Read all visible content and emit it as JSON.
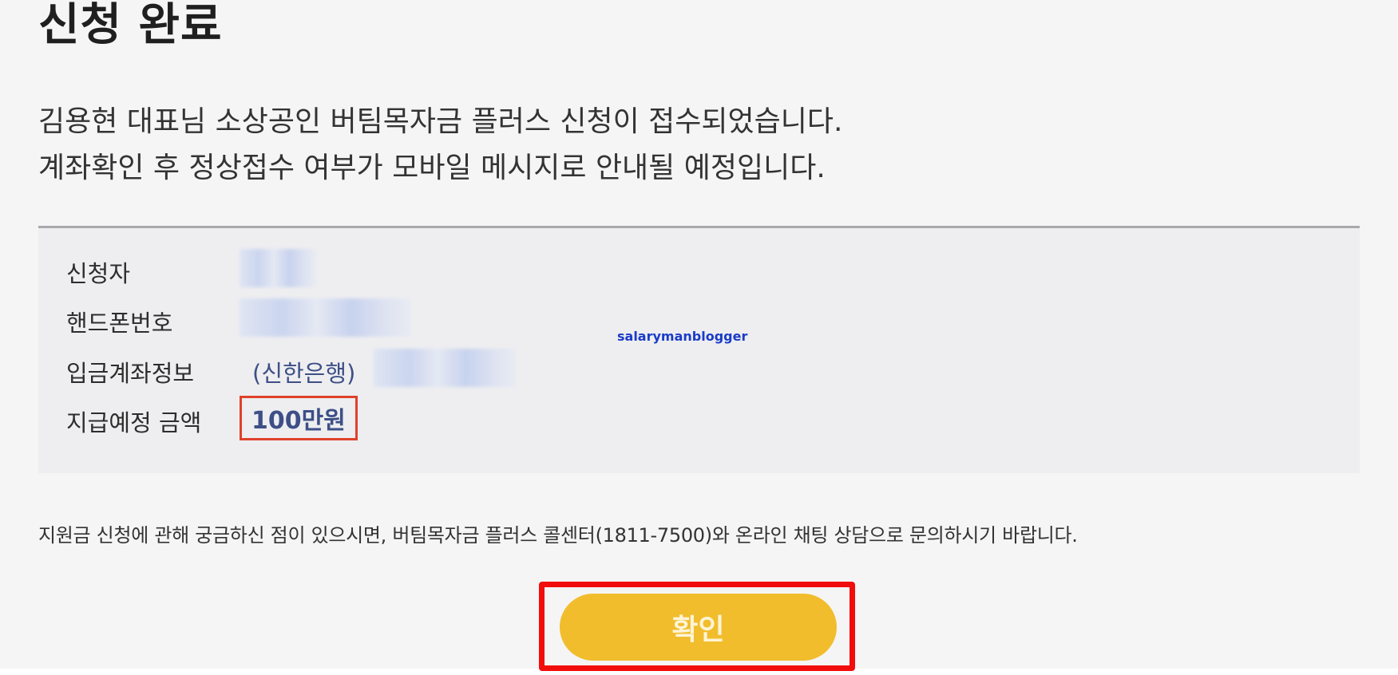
{
  "page": {
    "title": "신청 완료",
    "message_line1": "김용현 대표님 소상공인 버팀목자금 플러스 신청이 접수되었습니다.",
    "message_line2": "계좌확인 후 정상접수 여부가 모바일 메시지로 안내될 예정입니다."
  },
  "info": {
    "applicant_label": "신청자",
    "phone_label": "핸드폰번호",
    "account_label": "입금계좌정보",
    "bank_name": "(신한은행)",
    "amount_label": "지급예정 금액",
    "amount_value": "100만원"
  },
  "watermark": "salarymanblogger",
  "footer": {
    "note": "지원금 신청에 관해 궁금하신 점이 있으시면, 버팀목자금 플러스 콜센터(1811-7500)와 온라인 채팅 상담으로 문의하시기 바랍니다."
  },
  "actions": {
    "confirm_label": "확인"
  },
  "colors": {
    "button": "#f1bd2d",
    "highlight": "#f20d0d",
    "amount_box": "#e0412b",
    "value_text": "#3d4f86"
  }
}
